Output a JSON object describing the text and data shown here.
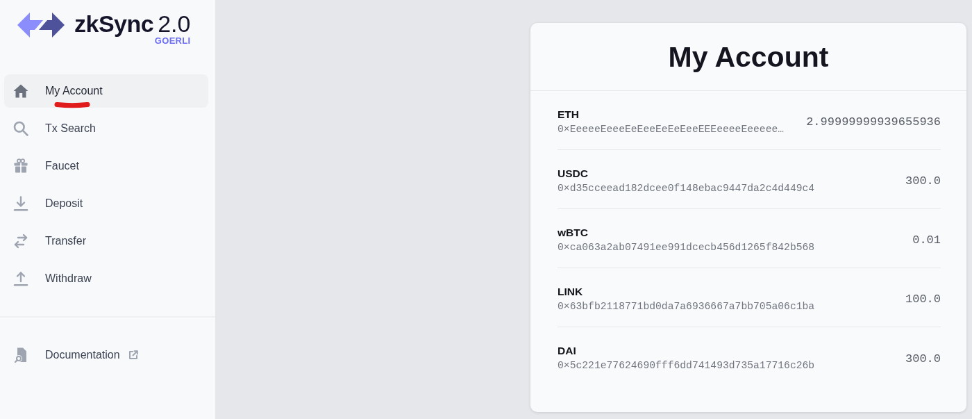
{
  "sidebar": {
    "logo": {
      "wordmark": "zkSync",
      "version": "2.0",
      "network": "GOERLI"
    },
    "nav_items": [
      {
        "label": "My Account",
        "selected": true
      },
      {
        "label": "Tx Search",
        "selected": false
      },
      {
        "label": "Faucet",
        "selected": false
      },
      {
        "label": "Deposit",
        "selected": false
      },
      {
        "label": "Transfer",
        "selected": false
      },
      {
        "label": "Withdraw",
        "selected": false
      }
    ],
    "footer_links": [
      {
        "label": "Documentation",
        "external": true
      }
    ]
  },
  "account": {
    "title": "My Account",
    "tokens": [
      {
        "symbol": "ETH",
        "address": "0×EeeeeEeeeEeEeeEeEeEeeEEEeeeeEeeeee…",
        "balance": "2.99999999939655936"
      },
      {
        "symbol": "USDC",
        "address": "0×d35cceead182dcee0f148ebac9447da2c4d449c4",
        "balance": "300.0"
      },
      {
        "symbol": "wBTC",
        "address": "0×ca063a2ab07491ee991dcecb456d1265f842b568",
        "balance": "0.01"
      },
      {
        "symbol": "LINK",
        "address": "0×63bfb2118771bd0da7a6936667a7bb705a06c1ba",
        "balance": "100.0"
      },
      {
        "symbol": "DAI",
        "address": "0×5c221e77624690fff6dd741493d735a17716c26b",
        "balance": "300.0"
      }
    ]
  }
}
